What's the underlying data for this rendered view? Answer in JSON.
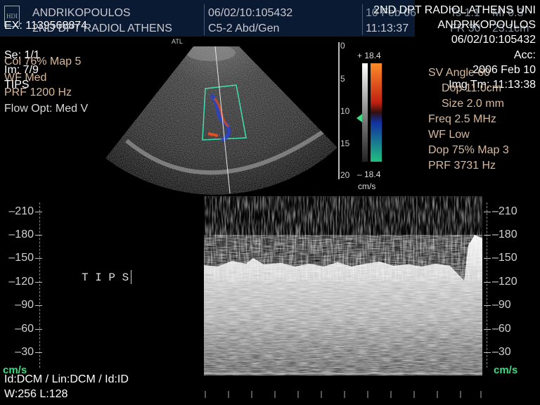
{
  "header": {
    "patient_name": "ANDRIKOPOULOS",
    "exam_id": "EX: 1139568874",
    "department": "2ND DPT RADIOL ATHENS",
    "study_id": "06/02/10:105432",
    "probe": "C5-2 Abd/Gen",
    "date_short": "10 Feb 06",
    "time": "11:13:37",
    "ts": "Ts 1.1",
    "mi": "MI 0.3",
    "fr": "FR 30",
    "depth_cm": "23.1cm",
    "logo_text": "HDI"
  },
  "right_header": {
    "institution": "2ND DPT RADIOL ATHENS UNI",
    "patient": "ANDRIKOPOULOS",
    "study": "06/02/10:105432",
    "acc": "Acc:",
    "date": "2006 Feb 10",
    "img_tm": "Img Tm: 11:13:38"
  },
  "left_params": {
    "se": "Se: 1/1",
    "col": "Col 76%  Map 5",
    "im": "Im: 7/9",
    "wf": "WF Med",
    "label": "TIPS",
    "prf": "PRF 1200  Hz",
    "flow": "Flow Opt: Med V"
  },
  "right_params": {
    "sv_angle": "SV Angle 60",
    "dop_depth": "Dop 11.0cm",
    "size": "Size 2.0  mm",
    "freq": "Freq 2.5  MHz",
    "wf": "WF Low",
    "dop": "Dop 75%  Map 3",
    "prf": "PRF 3731  Hz"
  },
  "probe_label": "ATL",
  "color_bar": {
    "top": "+ 18.4",
    "bottom": "– 18.4",
    "unit": "cm/s",
    "depth_ticks": [
      "0",
      "5",
      "10",
      "15",
      "20"
    ]
  },
  "spectral": {
    "annotation": "T I P S",
    "unit": "cm/s",
    "scale": [
      "–210",
      "–180",
      "–150",
      "–120",
      "–90",
      "–60",
      "–30"
    ]
  },
  "footer": {
    "line1": "Id:DCM / Lin:DCM / Id:ID",
    "line2": "W:256  L:128"
  },
  "colors": {
    "header_bg": "#0b1a33",
    "param_tan": "#d9b99b",
    "unit_green": "#3ddc84",
    "roi_box": "#3fe0b0"
  }
}
